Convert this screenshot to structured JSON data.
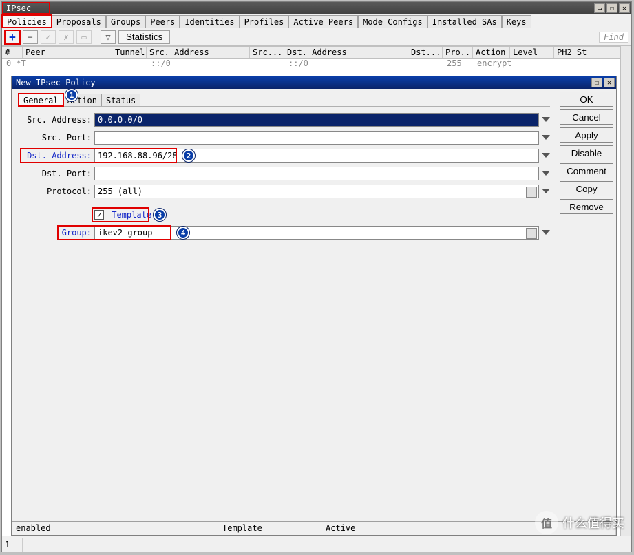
{
  "main_window": {
    "title": "IPsec",
    "tabs": [
      "Policies",
      "Proposals",
      "Groups",
      "Peers",
      "Identities",
      "Profiles",
      "Active Peers",
      "Mode Configs",
      "Installed SAs",
      "Keys"
    ],
    "active_tab": 0,
    "toolbar": {
      "add": "+",
      "stats": "Statistics",
      "find": "Find"
    },
    "columns": [
      "#",
      "Peer",
      "Tunnel",
      "Src. Address",
      "Src....",
      "Dst. Address",
      "Dst....",
      "Pro...",
      "Action",
      "Level",
      "PH2 St"
    ],
    "row": {
      "num": "0 *T",
      "src": "::/0",
      "dst": "::/0",
      "proto": "255",
      "action": "encrypt"
    },
    "status_count": "1"
  },
  "dialog": {
    "title": "New IPsec Policy",
    "tabs": [
      "General",
      "Action",
      "Status"
    ],
    "active_tab": 0,
    "buttons": [
      "OK",
      "Cancel",
      "Apply",
      "Disable",
      "Comment",
      "Copy",
      "Remove"
    ],
    "form": {
      "src_addr_label": "Src. Address:",
      "src_addr": "0.0.0.0/0",
      "src_port_label": "Src. Port:",
      "src_port": "",
      "dst_addr_label": "Dst. Address:",
      "dst_addr": "192.168.88.96/28",
      "dst_port_label": "Dst. Port:",
      "dst_port": "",
      "proto_label": "Protocol:",
      "proto": "255 (all)",
      "template_label": "Template",
      "template_checked": true,
      "group_label": "Group:",
      "group": "ikev2-group"
    },
    "status": {
      "s1": "enabled",
      "s2": "Template",
      "s3": "Active"
    }
  },
  "annotations": {
    "b1": "1",
    "b2": "2",
    "b3": "3",
    "b4": "4"
  },
  "watermark": "什么值得买"
}
